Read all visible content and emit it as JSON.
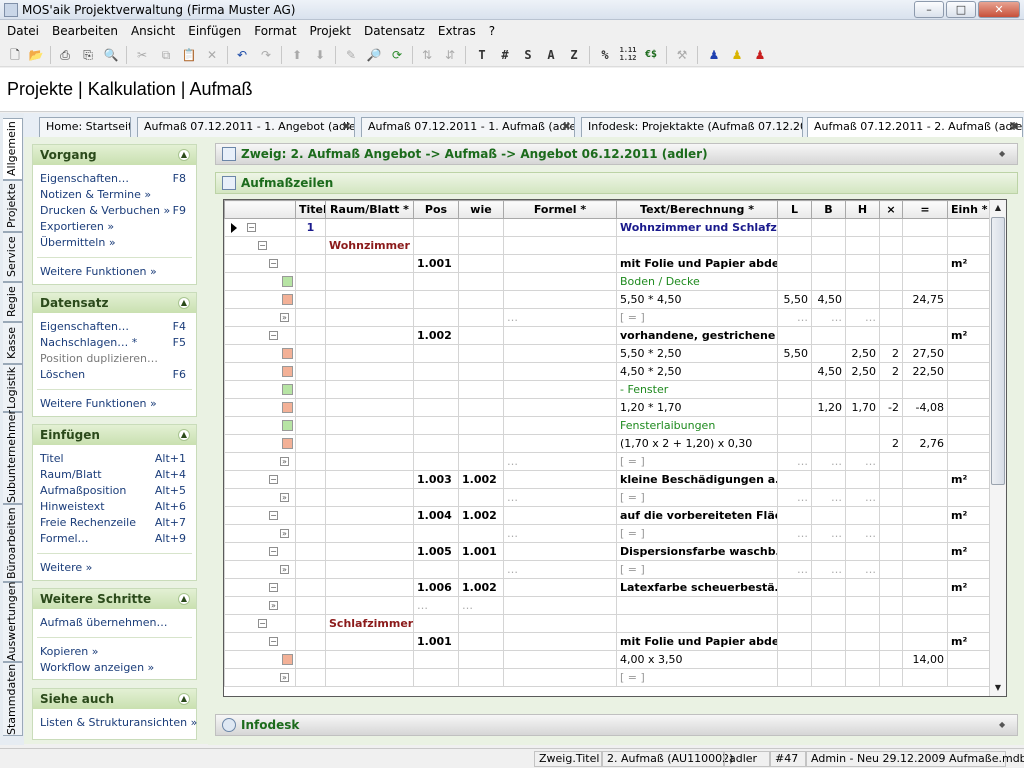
{
  "window": {
    "title": "MOS'aik Projektverwaltung (Firma Muster AG)",
    "min": "–",
    "max": "□",
    "close": "✕"
  },
  "menu": [
    "Datei",
    "Bearbeiten",
    "Ansicht",
    "Einfügen",
    "Format",
    "Projekt",
    "Datensatz",
    "Extras",
    "?"
  ],
  "toolbar": {
    "text_buttons": [
      "T",
      "#",
      "S",
      "A",
      "Z",
      "%",
      "1.11 1.12",
      "€$"
    ]
  },
  "header": {
    "title": "Projekte | Kalkulation | Aufmaß"
  },
  "doc_tabs": [
    {
      "label": "Home: Startseite",
      "closable": false
    },
    {
      "label": "Aufmaß 07.12.2011 - 1. Angebot (adler)",
      "closable": true
    },
    {
      "label": "Aufmaß 07.12.2011 - 1. Aufmaß (adler)",
      "closable": true
    },
    {
      "label": "Infodesk: Projektakte (Aufmaß 07.12.2011)",
      "closable": false
    },
    {
      "label": "Aufmaß 07.12.2011 - 2. Aufmaß (adler)",
      "closable": true,
      "active": true
    }
  ],
  "side_tabs": [
    "Allgemein",
    "Projekte",
    "Service",
    "Regie",
    "Kasse",
    "Logistik",
    "Subunternehmer",
    "Büroarbeiten",
    "Auswertungen",
    "Stammdaten"
  ],
  "sidebar": {
    "vorgang": {
      "title": "Vorgang",
      "items": [
        {
          "label": "Eigenschaften…",
          "shortcut": "F8"
        },
        {
          "label": "Notizen & Termine »",
          "shortcut": ""
        },
        {
          "label": "Drucken & Verbuchen »",
          "shortcut": "F9"
        },
        {
          "label": "Exportieren »",
          "shortcut": ""
        },
        {
          "label": "Übermitteln »",
          "shortcut": ""
        }
      ],
      "more": "Weitere Funktionen »"
    },
    "datensatz": {
      "title": "Datensatz",
      "items": [
        {
          "label": "Eigenschaften…",
          "shortcut": "F4"
        },
        {
          "label": "Nachschlagen… *",
          "shortcut": "F5"
        },
        {
          "label": "Position duplizieren…",
          "shortcut": "",
          "disabled": true
        },
        {
          "label": "Löschen",
          "shortcut": "F6"
        }
      ],
      "more": "Weitere Funktionen »"
    },
    "einfuegen": {
      "title": "Einfügen",
      "items": [
        {
          "label": "Titel",
          "shortcut": "Alt+1"
        },
        {
          "label": "Raum/Blatt",
          "shortcut": "Alt+4"
        },
        {
          "label": "Aufmaßposition",
          "shortcut": "Alt+5"
        },
        {
          "label": "Hinweistext",
          "shortcut": "Alt+6"
        },
        {
          "label": "Freie Rechenzeile",
          "shortcut": "Alt+7"
        },
        {
          "label": "Formel…",
          "shortcut": "Alt+9"
        }
      ],
      "more": "Weitere »"
    },
    "schritte": {
      "title": "Weitere Schritte",
      "items": [
        {
          "label": "Aufmaß übernehmen…",
          "shortcut": ""
        },
        {
          "label": "Kopieren »",
          "shortcut": ""
        },
        {
          "label": "Workflow anzeigen »",
          "shortcut": ""
        }
      ]
    },
    "siehe": {
      "title": "Siehe auch",
      "items": [
        {
          "label": "Listen & Strukturansichten »",
          "shortcut": ""
        }
      ]
    }
  },
  "main": {
    "branch": "Zweig: 2. Aufmaß Angebot -> Aufmaß -> Angebot 06.12.2011 (adler)",
    "rows_title": "Aufmaßzeilen",
    "infodesk": "Infodesk"
  },
  "table": {
    "columns": [
      "",
      "Titel",
      "Raum/Blatt *",
      "Pos",
      "wie",
      "Formel *",
      "Text/Berechnung *",
      "L",
      "B",
      "H",
      "×",
      "=",
      "Einh *"
    ],
    "rows": [
      {
        "lvl": 0,
        "icon": "node-minus",
        "ptr": true,
        "titel": "1",
        "raum": "",
        "pos": "",
        "wie": "",
        "formel": "",
        "text": "Wohnzimmer und Schlafzi…",
        "tstyle": "blue",
        "L": "",
        "B": "",
        "H": "",
        "x": "",
        "eq": "",
        "einh": ""
      },
      {
        "lvl": 1,
        "icon": "node-minus",
        "titel": "",
        "raum": "Wohnzimmer",
        "pos": "",
        "wie": "",
        "formel": "",
        "text": "",
        "tstyle": "",
        "L": "",
        "B": "",
        "H": "",
        "x": "",
        "eq": "",
        "einh": ""
      },
      {
        "lvl": 2,
        "icon": "node-minus",
        "titel": "",
        "raum": "",
        "pos": "1.001",
        "wie": "",
        "formel": "",
        "text": "mit Folie und Papier abde…",
        "tstyle": "b",
        "L": "",
        "B": "",
        "H": "",
        "x": "",
        "eq": "",
        "einh": "m²"
      },
      {
        "lvl": 3,
        "icon": "sq-green",
        "titel": "",
        "raum": "",
        "pos": "",
        "wie": "",
        "formel": "",
        "text": "Boden / Decke",
        "tstyle": "green",
        "L": "",
        "B": "",
        "H": "",
        "x": "",
        "eq": "",
        "einh": ""
      },
      {
        "lvl": 3,
        "icon": "sq-orange",
        "titel": "",
        "raum": "",
        "pos": "",
        "wie": "",
        "formel": "",
        "text": "5,50 * 4,50",
        "tstyle": "",
        "L": "5,50",
        "B": "4,50",
        "H": "",
        "x": "",
        "eq": "24,75",
        "einh": ""
      },
      {
        "lvl": 3,
        "icon": "node-sum",
        "titel": "",
        "raum": "",
        "pos": "",
        "wie": "",
        "formel": "…",
        "text": "[ = ]",
        "tstyle": "gray",
        "L": "…",
        "B": "…",
        "H": "…",
        "x": "",
        "eq": "",
        "einh": ""
      },
      {
        "lvl": 2,
        "icon": "node-minus",
        "titel": "",
        "raum": "",
        "pos": "1.002",
        "wie": "",
        "formel": "",
        "text": "vorhandene, gestrichene …",
        "tstyle": "b",
        "L": "",
        "B": "",
        "H": "",
        "x": "",
        "eq": "",
        "einh": "m²"
      },
      {
        "lvl": 3,
        "icon": "sq-orange",
        "titel": "",
        "raum": "",
        "pos": "",
        "wie": "",
        "formel": "",
        "text": "5,50 * 2,50",
        "tstyle": "",
        "L": "5,50",
        "B": "",
        "H": "2,50",
        "x": "2",
        "eq": "27,50",
        "einh": ""
      },
      {
        "lvl": 3,
        "icon": "sq-orange",
        "titel": "",
        "raum": "",
        "pos": "",
        "wie": "",
        "formel": "",
        "text": "4,50 * 2,50",
        "tstyle": "",
        "L": "",
        "B": "4,50",
        "H": "2,50",
        "x": "2",
        "eq": "22,50",
        "einh": ""
      },
      {
        "lvl": 3,
        "icon": "sq-green",
        "titel": "",
        "raum": "",
        "pos": "",
        "wie": "",
        "formel": "",
        "text": "- Fenster",
        "tstyle": "green",
        "L": "",
        "B": "",
        "H": "",
        "x": "",
        "eq": "",
        "einh": ""
      },
      {
        "lvl": 3,
        "icon": "sq-orange",
        "titel": "",
        "raum": "",
        "pos": "",
        "wie": "",
        "formel": "",
        "text": "1,20 * 1,70",
        "tstyle": "",
        "L": "",
        "B": "1,20",
        "H": "1,70",
        "x": "-2",
        "eq": "-4,08",
        "einh": ""
      },
      {
        "lvl": 3,
        "icon": "sq-green",
        "titel": "",
        "raum": "",
        "pos": "",
        "wie": "",
        "formel": "",
        "text": "Fensterlaibungen",
        "tstyle": "green",
        "L": "",
        "B": "",
        "H": "",
        "x": "",
        "eq": "",
        "einh": ""
      },
      {
        "lvl": 3,
        "icon": "sq-orange",
        "titel": "",
        "raum": "",
        "pos": "",
        "wie": "",
        "formel": "",
        "text": "(1,70 x 2 + 1,20) x 0,30",
        "tstyle": "",
        "L": "",
        "B": "",
        "H": "",
        "x": "2",
        "eq": "2,76",
        "einh": ""
      },
      {
        "lvl": 3,
        "icon": "node-sum",
        "titel": "",
        "raum": "",
        "pos": "",
        "wie": "",
        "formel": "…",
        "text": "[ = ]",
        "tstyle": "gray",
        "L": "…",
        "B": "…",
        "H": "…",
        "x": "",
        "eq": "",
        "einh": ""
      },
      {
        "lvl": 2,
        "icon": "node-minus",
        "titel": "",
        "raum": "",
        "pos": "1.003",
        "wie": "1.002",
        "formel": "",
        "text": "kleine Beschädigungen a…",
        "tstyle": "b",
        "L": "",
        "B": "",
        "H": "",
        "x": "",
        "eq": "",
        "einh": "m²"
      },
      {
        "lvl": 3,
        "icon": "node-sum",
        "titel": "",
        "raum": "",
        "pos": "",
        "wie": "",
        "formel": "…",
        "text": "[ = ]",
        "tstyle": "gray",
        "L": "…",
        "B": "…",
        "H": "…",
        "x": "",
        "eq": "",
        "einh": ""
      },
      {
        "lvl": 2,
        "icon": "node-minus",
        "titel": "",
        "raum": "",
        "pos": "1.004",
        "wie": "1.002",
        "formel": "",
        "text": "auf die vorbereiteten Fläc…",
        "tstyle": "b",
        "L": "",
        "B": "",
        "H": "",
        "x": "",
        "eq": "",
        "einh": "m²"
      },
      {
        "lvl": 3,
        "icon": "node-sum",
        "titel": "",
        "raum": "",
        "pos": "",
        "wie": "",
        "formel": "…",
        "text": "[ = ]",
        "tstyle": "gray",
        "L": "…",
        "B": "…",
        "H": "…",
        "x": "",
        "eq": "",
        "einh": ""
      },
      {
        "lvl": 2,
        "icon": "node-minus",
        "titel": "",
        "raum": "",
        "pos": "1.005",
        "wie": "1.001",
        "formel": "",
        "text": "Dispersionsfarbe waschb…",
        "tstyle": "b",
        "L": "",
        "B": "",
        "H": "",
        "x": "",
        "eq": "",
        "einh": "m²"
      },
      {
        "lvl": 3,
        "icon": "node-sum",
        "titel": "",
        "raum": "",
        "pos": "",
        "wie": "",
        "formel": "…",
        "text": "[ = ]",
        "tstyle": "gray",
        "L": "…",
        "B": "…",
        "H": "…",
        "x": "",
        "eq": "",
        "einh": ""
      },
      {
        "lvl": 2,
        "icon": "node-minus",
        "titel": "",
        "raum": "",
        "pos": "1.006",
        "wie": "1.002",
        "formel": "",
        "text": "Latexfarbe scheuerbestä…",
        "tstyle": "b",
        "L": "",
        "B": "",
        "H": "",
        "x": "",
        "eq": "",
        "einh": "m²"
      },
      {
        "lvl": 2,
        "icon": "node-sum",
        "titel": "",
        "raum": "",
        "pos": "…",
        "wie": "…",
        "formel": "",
        "text": "",
        "tstyle": "",
        "L": "",
        "B": "",
        "H": "",
        "x": "",
        "eq": "",
        "einh": ""
      },
      {
        "lvl": 1,
        "icon": "node-minus",
        "titel": "",
        "raum": "Schlafzimmer",
        "pos": "",
        "wie": "",
        "formel": "",
        "text": "",
        "tstyle": "",
        "L": "",
        "B": "",
        "H": "",
        "x": "",
        "eq": "",
        "einh": ""
      },
      {
        "lvl": 2,
        "icon": "node-minus",
        "titel": "",
        "raum": "",
        "pos": "1.001",
        "wie": "",
        "formel": "",
        "text": "mit Folie und Papier abde…",
        "tstyle": "b",
        "L": "",
        "B": "",
        "H": "",
        "x": "",
        "eq": "",
        "einh": "m²"
      },
      {
        "lvl": 3,
        "icon": "sq-orange",
        "titel": "",
        "raum": "",
        "pos": "",
        "wie": "",
        "formel": "",
        "text": "4,00 x 3,50",
        "tstyle": "",
        "L": "",
        "B": "",
        "H": "",
        "x": "",
        "eq": "14,00",
        "einh": ""
      },
      {
        "lvl": 3,
        "icon": "node-sum",
        "titel": "",
        "raum": "",
        "pos": "",
        "wie": "",
        "formel": "",
        "text": "[ = ]",
        "tstyle": "gray",
        "L": "",
        "B": "",
        "H": "",
        "x": "",
        "eq": "",
        "einh": ""
      }
    ]
  },
  "status": [
    "Zweig.Titel",
    "2. Aufmaß (AU110002)",
    "adler",
    "#47",
    "Admin - Neu 29.12.2009 Aufmaße.mdb"
  ]
}
